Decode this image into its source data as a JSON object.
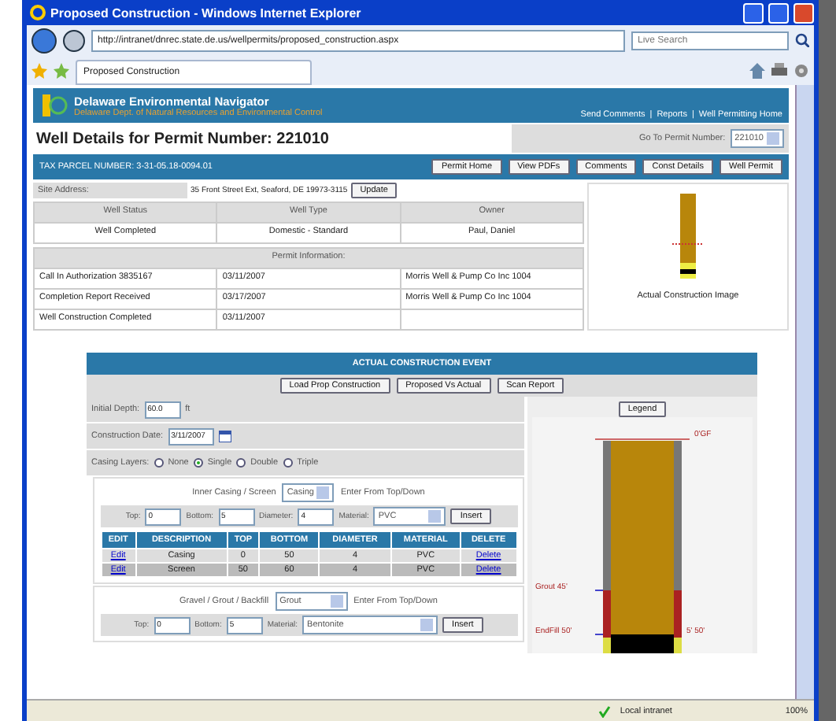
{
  "window": {
    "title": "Proposed Construction - Windows Internet Explorer"
  },
  "address_bar": {
    "url": "http://intranet/dnrec.state.de.us/wellpermits/proposed_construction.aspx"
  },
  "search": {
    "placeholder": "Live Search"
  },
  "tab": {
    "label": "Proposed Construction"
  },
  "site": {
    "title": "Delaware Environmental Navigator",
    "subtitle": "Delaware Dept. of Natural Resources and Environmental Control",
    "links": [
      "Send Comments",
      "Reports",
      "Well Permitting Home"
    ],
    "separator": "|"
  },
  "page_title": "Well Details for Permit Number: 221010",
  "goto": {
    "label": "Go To Permit Number:",
    "value": "221010"
  },
  "parcel": "TAX PARCEL NUMBER: 3-31-05.18-0094.01",
  "nav_buttons": [
    "Permit Home",
    "View PDFs",
    "Comments",
    "Const Details",
    "Well Permit"
  ],
  "site_address": {
    "label": "Site Address:",
    "value": "35 Front Street Ext, Seaford, DE 19973-3115",
    "button": "Update"
  },
  "status_table": {
    "columns": [
      "Well Status",
      "Well Type",
      "Owner"
    ],
    "row": [
      "Well Completed",
      "Domestic - Standard",
      "Paul, Daniel"
    ]
  },
  "permit_info": {
    "title": "Permit Information:",
    "rows": [
      [
        "Call In Authorization 3835167",
        "03/11/2007",
        "Morris Well & Pump Co Inc 1004"
      ],
      [
        "Completion Report Received",
        "03/17/2007",
        "Morris Well & Pump Co Inc 1004"
      ],
      [
        "Well Construction Completed",
        "03/11/2007",
        ""
      ]
    ]
  },
  "construction_image": {
    "caption": "Actual Construction Image"
  },
  "event": {
    "title": "ACTUAL CONSTRUCTION EVENT",
    "buttons": [
      "Load Prop Construction",
      "Proposed Vs Actual",
      "Scan Report"
    ],
    "initial_depth": {
      "label": "Initial Depth:",
      "value": "60.0",
      "unit": "ft"
    },
    "construction_date": {
      "label": "Construction Date:",
      "value": "3/11/2007"
    },
    "casing_layers": {
      "label": "Casing Layers:",
      "options": [
        {
          "label": "None",
          "selected": false
        },
        {
          "label": "Single",
          "selected": true
        },
        {
          "label": "Double",
          "selected": false
        },
        {
          "label": "Triple",
          "selected": false
        }
      ]
    },
    "inner_casing": {
      "label": "Inner Casing / Screen",
      "select": "Casing",
      "hint": "Enter From Top/Down",
      "fields": [
        {
          "label": "Top:",
          "value": "0"
        },
        {
          "label": "Bottom:",
          "value": "5"
        },
        {
          "label": "Diameter:",
          "value": "4"
        }
      ],
      "material_label": "Material:",
      "material": "PVC",
      "insert": "Insert",
      "columns": [
        "EDIT",
        "DESCRIPTION",
        "TOP",
        "BOTTOM",
        "DIAMETER",
        "MATERIAL",
        "DELETE"
      ],
      "rows": [
        {
          "cells": [
            {
              "kind": "link",
              "text": "Edit"
            },
            {
              "kind": "text",
              "text": "Casing"
            },
            {
              "kind": "text",
              "text": "0"
            },
            {
              "kind": "text",
              "text": "50"
            },
            {
              "kind": "text",
              "text": "4"
            },
            {
              "kind": "text",
              "text": "PVC"
            },
            {
              "kind": "link",
              "text": "Delete"
            }
          ]
        },
        {
          "cells": [
            {
              "kind": "link",
              "text": "Edit"
            },
            {
              "kind": "text",
              "text": "Screen"
            },
            {
              "kind": "text",
              "text": "50"
            },
            {
              "kind": "text",
              "text": "60"
            },
            {
              "kind": "text",
              "text": "4"
            },
            {
              "kind": "text",
              "text": "PVC"
            },
            {
              "kind": "link",
              "text": "Delete"
            }
          ]
        }
      ]
    },
    "gravel": {
      "label": "Gravel / Grout / Backfill",
      "select": "Grout",
      "hint": "Enter From Top/Down",
      "fields": [
        {
          "label": "Top:",
          "value": "0"
        },
        {
          "label": "Bottom:",
          "value": "5"
        }
      ],
      "material_label": "Material:",
      "material": "Bentonite",
      "insert": "Insert"
    },
    "legend_button": "Legend",
    "diagram_labels": {
      "top": "0'GF",
      "grout": "Grout 45'",
      "fill_left": "EndFill 50'",
      "fill_right": "5' 50'"
    }
  },
  "status_bar": {
    "zone": "Local intranet",
    "zoom": "100%"
  }
}
